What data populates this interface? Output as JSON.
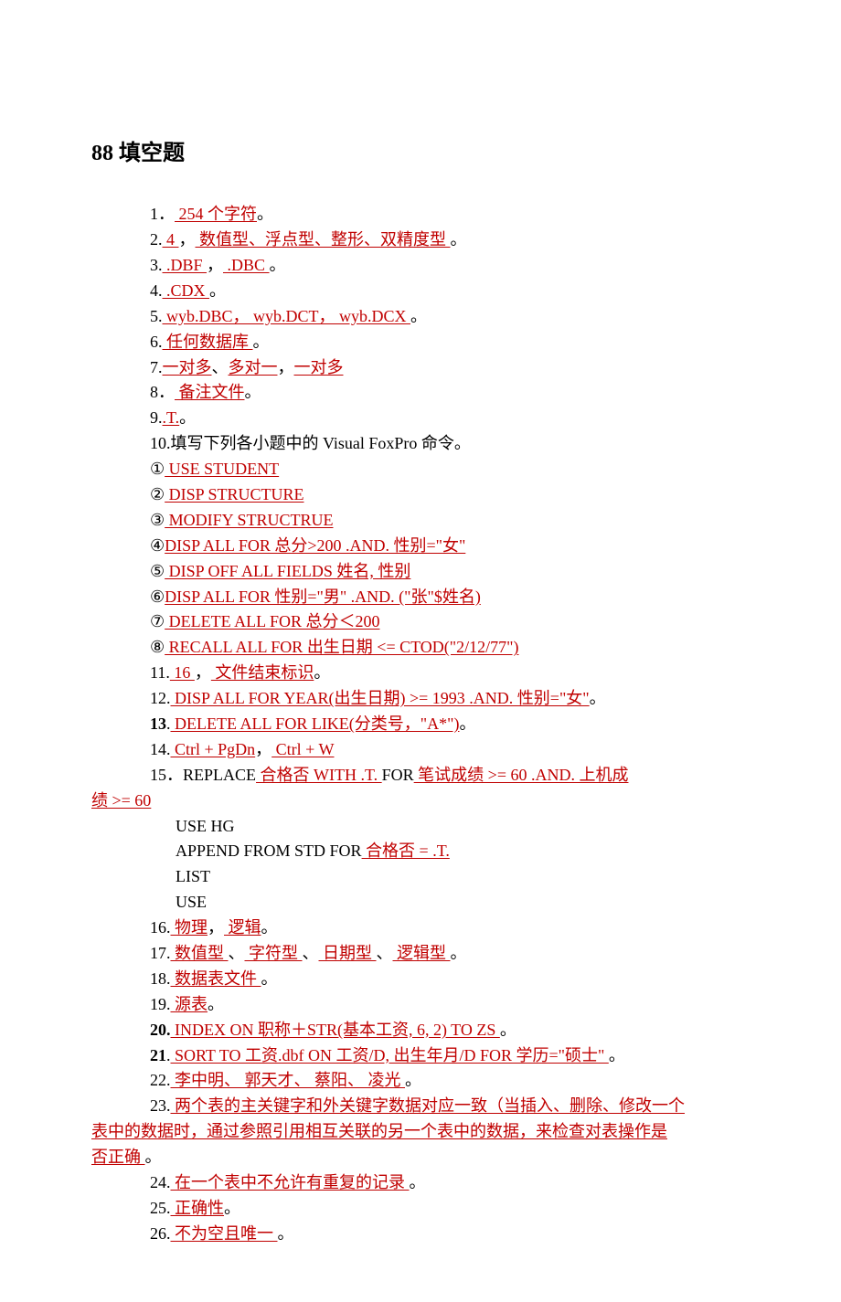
{
  "title": "88 填空题",
  "t1a": "  254 个字符",
  "t2a": "  4    ",
  "t2b": "   数值型、浮点型、整形、双精度型  ",
  "t3a": "   .DBF    ",
  "t3b": "   .DBC    ",
  "t4a": "  .CDX    ",
  "t5a": "  wyb.DBC，     wyb.DCT，       wyb.DCX    ",
  "t6a": "  任何数据库  ",
  "t7a": "一对多",
  "t7b": "多对一",
  "t7c": "一对多",
  "t8a": "  备注文件",
  "t9a": ".T.",
  "t10": "10.填写下列各小题中的 Visual FoxPro 命令。",
  "t10_1": "       USE   STUDENT                         ",
  "t10_2": "  DISP   STRUCTURE          ",
  "t10_3": "            MODIFY   STRUCTRUE    ",
  "t10_4": "DISP   ALL   FOR   总分>200 .AND.  性别=\"女\"",
  "t10_5": "      DISP   OFF   ALL   FIELDS   姓名, 性别                          ",
  "t10_6": "DISP   ALL   FOR  性别=\"男\" .AND. (\"张\"$姓名)",
  "t10_7": "  DELETE   ALL   FOR    总分＜200                     ",
  "t10_8": "  RECALL   ALL   FOR   出生日期 <= CTOD(\"2/12/77\")           ",
  "t11a": " 16  ",
  "t11b": "  文件结束标识",
  "t12a": "  DISP   ALL   FOR   YEAR(出生日期) >= 1993 .AND.  性别=\"女\"",
  "t13a": "  DELETE   ALL   FOR   LIKE(分类号，\"A*\")",
  "t14a": " Ctrl + PgDn",
  "t14b": "  Ctrl + W",
  "t15pre": "15．REPLACE",
  "t15a": " 合格否  WITH   .T.  ",
  "t15mid": "FOR",
  "t15b": "  笔试成绩  >= 60 .AND.  上机成",
  "t15b2": "绩  >= 60",
  "t15l1": "USE   HG",
  "t15l2pre": "APPEND   FROM   STD   FOR",
  "t15l2a": "  合格否  = .T.   ",
  "t15l3": "LIST",
  "t15l4": "USE",
  "t16a": "  物理",
  "t16b": "  逻辑",
  "t17a": "  数值型  ",
  "t17b": "  字符型  ",
  "t17c": "  日期型  ",
  "t17d": "  逻辑型  ",
  "t18a": "  数据表文件  ",
  "t19a": "  源表",
  "t20a": " INDEX   ON  职称＋STR(基本工资, 6, 2) TO   ZS  ",
  "t21a": " SORT   TO  工资.dbf   ON  工资/D,  出生年月/D   FOR   学历=\"硕士\"  ",
  "t22a": "  李中明、  郭天才、  蔡阳、  凌光  ",
  "t23a": "  两个表的主关键字和外关键字数据对应一致（当插入、删除、修改一个",
  "t23b": "表中的数据时，通过参照引用相互关联的另一个表中的数据，来检查对表操作是",
  "t23c": "否正确  ",
  "t24a": "  在一个表中不允许有重复的记录  ",
  "t25a": "  正确性",
  "t26a": "  不为空且唯一   "
}
